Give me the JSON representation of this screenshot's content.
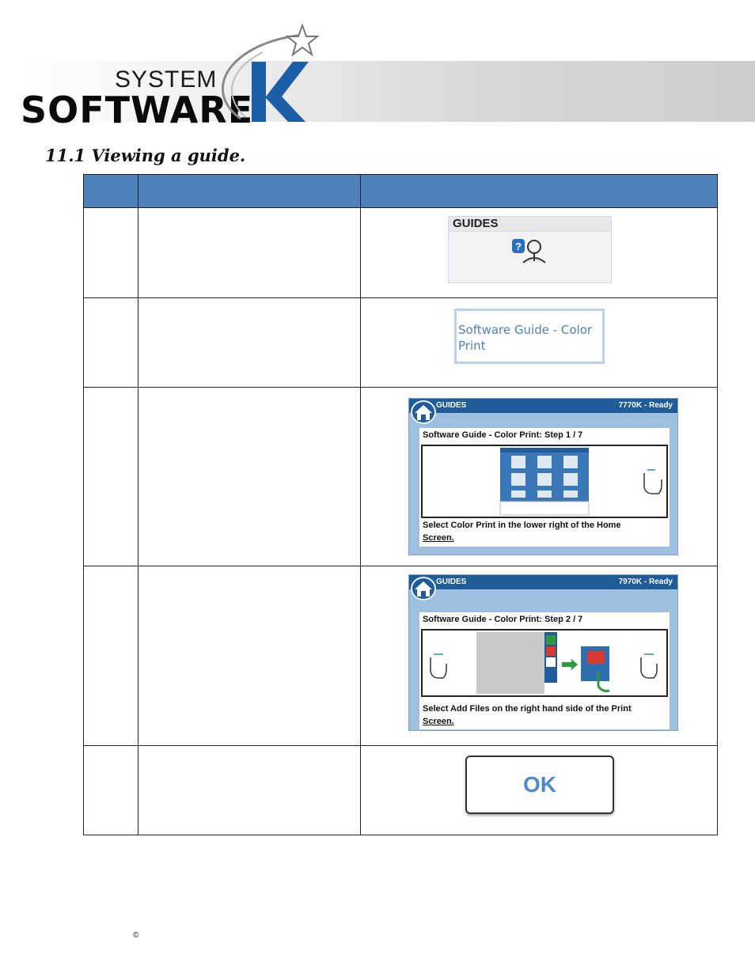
{
  "header": {
    "logo_system": "SYSTEM",
    "logo_software": "SOFTWARE"
  },
  "section_title": "11.1 Viewing a guide.",
  "table": {
    "header": [
      "",
      "",
      ""
    ],
    "rows": [
      {
        "thumb_type": "guides-widget",
        "label": "GUIDES"
      },
      {
        "thumb_type": "guide-item",
        "label": "Software Guide - Color Print"
      },
      {
        "thumb_type": "screen",
        "bar_left": "GUIDES",
        "bar_right": "7770K - Ready",
        "panel_title": "Software Guide - Color Print: Step 1 / 7",
        "caption_line1": "Select  Color Print in the lower  right of the Home",
        "caption_line2": "Screen."
      },
      {
        "thumb_type": "screen",
        "bar_left": "GUIDES",
        "bar_right": "7970K - Ready",
        "panel_title": "Software Guide - Color Print: Step 2 / 7",
        "caption_line1": "Select Add Files on the right hand side of the Print",
        "caption_line2": "Screen."
      },
      {
        "thumb_type": "ok-button",
        "label": "OK"
      }
    ]
  },
  "footer": {
    "copyright": "©"
  },
  "colors": {
    "table_header": "#4f81bd",
    "screen_bar": "#1f5c99",
    "ok_text": "#4a8ad0"
  }
}
